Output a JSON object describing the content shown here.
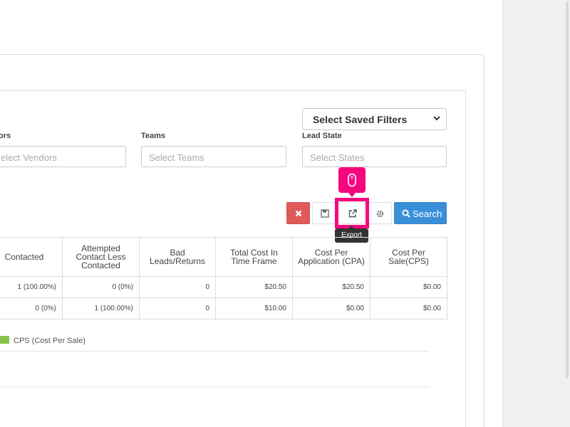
{
  "filters": {
    "saved_filters": "Select Saved Filters",
    "vendors": {
      "label": "ors",
      "placeholder": "elect Vendors"
    },
    "teams": {
      "label": "Teams",
      "placeholder": "Select Teams"
    },
    "lead_state": {
      "label": "Lead State",
      "placeholder": "Select States"
    }
  },
  "toolbar": {
    "clear_icon": "times-icon",
    "save_icon": "floppy-icon",
    "export_icon": "external-link-icon",
    "settings_icon": "gear-icon",
    "search_label": "Search",
    "export_tooltip": "Export"
  },
  "table": {
    "headers": [
      "Contacted",
      "Attempted Contact Less Contacted",
      "Bad Leads/Returns",
      "Total Cost In Time Frame",
      "Cost Per Application (CPA)",
      "Cost Per Sale(CPS)"
    ],
    "rows": [
      [
        "1 (100.00%)",
        "0 (0%)",
        "0",
        "$20.50",
        "$20.50",
        "$0.00"
      ],
      [
        "0 (0%)",
        "1 (100.00%)",
        "0",
        "$10.00",
        "$0.00",
        "$0.00"
      ]
    ]
  },
  "chart": {
    "legend_label": "CPS (Cost Per Sale)",
    "legend_color": "#8bc34a"
  },
  "colors": {
    "danger": "#e05a5a",
    "primary": "#3a8fd9",
    "highlight": "#f5087f"
  }
}
